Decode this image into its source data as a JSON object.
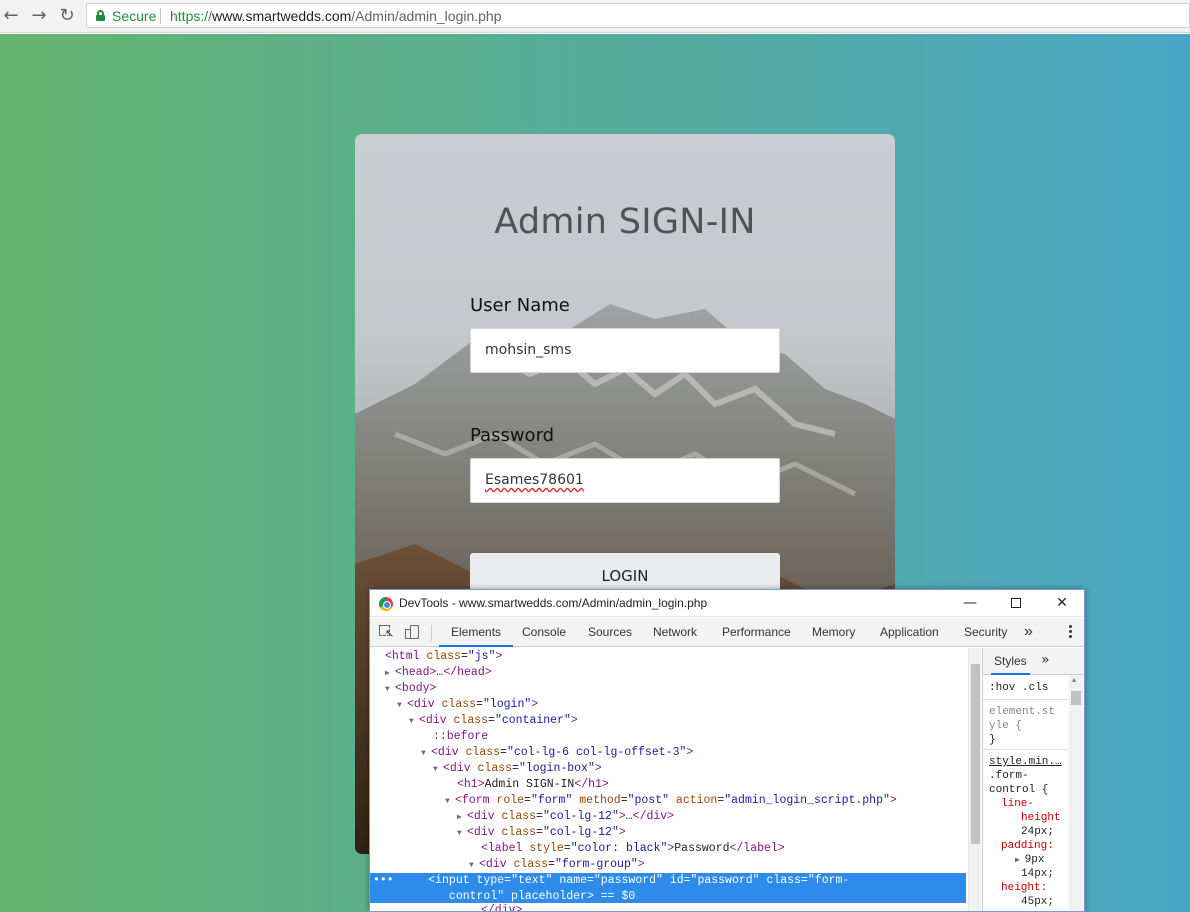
{
  "browser": {
    "secure_label": "Secure",
    "url_scheme": "https://",
    "url_host": "www.smartwedds.com",
    "url_path": "/Admin/admin_login.php"
  },
  "login": {
    "title": "Admin SIGN-IN",
    "username_label": "User Name",
    "username_value": "mohsin_sms",
    "password_label": "Password",
    "password_value": "Esames78601",
    "login_button": "LOGIN"
  },
  "devtools": {
    "window_title": "DevTools - www.smartwedds.com/Admin/admin_login.php",
    "tabs": [
      "Elements",
      "Console",
      "Sources",
      "Network",
      "Performance",
      "Memory",
      "Application",
      "Security"
    ],
    "active_tab": "Elements",
    "more_tabs": "»",
    "styles_tab": "Styles",
    "styles": {
      "filter_hov": ":hov",
      "filter_cls": ".cls",
      "element_style_1": "element.st",
      "element_style_2": "yle {",
      "element_style_3": "}",
      "rule_source": "style.min.…",
      "selector_1": ".form-",
      "selector_2": "control {",
      "prop_1": "line-",
      "prop_1b": "height",
      "val_1": "24px;",
      "prop_2": "padding:",
      "val_2a": "9px",
      "val_2b": "14px;",
      "prop_3": "height:",
      "val_3": "45px;"
    }
  },
  "colors": {
    "secure_green": "#1e8e3e",
    "page_gradient_start": "#66b46f",
    "page_gradient_end": "#4aa5c5",
    "selection_blue": "#2d8ceb",
    "tab_underline": "#1a73e8"
  }
}
